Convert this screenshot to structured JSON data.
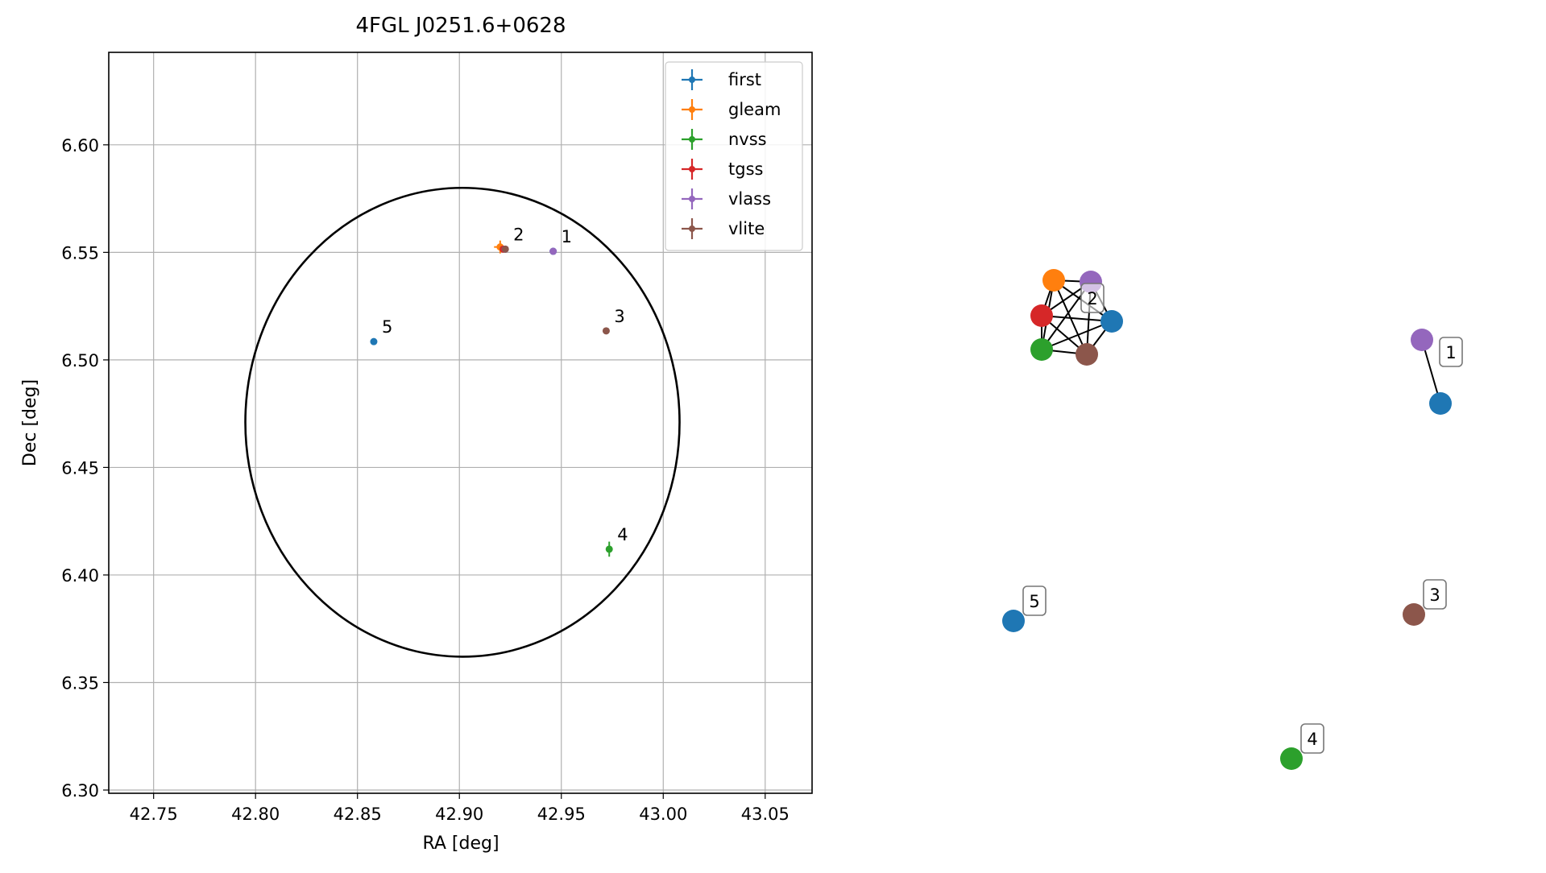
{
  "chart_data": [
    {
      "type": "scatter",
      "title": "4FGL J0251.6+0628",
      "xlabel": "RA [deg]",
      "ylabel": "Dec [deg]",
      "xlim": [
        42.728,
        43.073
      ],
      "ylim": [
        6.2985,
        6.643
      ],
      "xticks": [
        42.75,
        42.8,
        42.85,
        42.9,
        42.95,
        43.0,
        43.05
      ],
      "xtick_labels": [
        "42.75",
        "42.80",
        "42.85",
        "42.90",
        "42.95",
        "43.00",
        "43.05"
      ],
      "yticks": [
        6.3,
        6.35,
        6.4,
        6.45,
        6.5,
        6.55,
        6.6
      ],
      "ytick_labels": [
        "6.30",
        "6.35",
        "6.40",
        "6.45",
        "6.50",
        "6.55",
        "6.60"
      ],
      "grid": true,
      "legend_position": "top-right",
      "series": [
        {
          "name": "first",
          "color": "#1f77b4",
          "points": [
            {
              "x": 42.946,
              "y": 6.5505,
              "xerr": 0.0005,
              "yerr": 0.0005
            },
            {
              "x": 42.858,
              "y": 6.5085,
              "xerr": 0.0005,
              "yerr": 0.0005
            }
          ]
        },
        {
          "name": "gleam",
          "color": "#ff7f0e",
          "points": [
            {
              "x": 42.92,
              "y": 6.5525,
              "xerr": 0.003,
              "yerr": 0.003
            }
          ]
        },
        {
          "name": "nvss",
          "color": "#2ca02c",
          "points": [
            {
              "x": 42.9735,
              "y": 6.412,
              "xerr": 0.0006,
              "yerr": 0.0035
            }
          ]
        },
        {
          "name": "tgss",
          "color": "#d62728",
          "points": [
            {
              "x": 42.9215,
              "y": 6.5515,
              "xerr": 0.001,
              "yerr": 0.001
            }
          ]
        },
        {
          "name": "vlass",
          "color": "#9467bd",
          "points": [
            {
              "x": 42.946,
              "y": 6.5505,
              "xerr": 0.0004,
              "yerr": 0.0004
            },
            {
              "x": 42.9225,
              "y": 6.5515,
              "xerr": 0.0004,
              "yerr": 0.0004
            }
          ]
        },
        {
          "name": "vlite",
          "color": "#8c564b",
          "points": [
            {
              "x": 42.9225,
              "y": 6.5515,
              "xerr": 0.0008,
              "yerr": 0.0008
            },
            {
              "x": 42.972,
              "y": 6.5135,
              "xerr": 0.0008,
              "yerr": 0.0008
            }
          ]
        }
      ],
      "ellipse": {
        "center": [
          42.9015,
          6.471
        ],
        "semi_axes": [
          0.1065,
          0.109
        ]
      },
      "annotations": [
        {
          "text": "1",
          "x": 42.946,
          "y": 6.5505
        },
        {
          "text": "2",
          "x": 42.9225,
          "y": 6.5515
        },
        {
          "text": "3",
          "x": 42.972,
          "y": 6.5135
        },
        {
          "text": "4",
          "x": 42.9735,
          "y": 6.412
        },
        {
          "text": "5",
          "x": 42.858,
          "y": 6.5085
        }
      ]
    },
    {
      "type": "network",
      "clusters": [
        {
          "label": "2",
          "nodes": [
            "#ff7f0e",
            "#9467bd",
            "#d62728",
            "#1f77b4",
            "#2ca02c",
            "#8c564b"
          ],
          "complete_graph": true
        },
        {
          "label": "1",
          "nodes": [
            "#9467bd",
            "#1f77b4"
          ],
          "complete_graph": true
        },
        {
          "label": "5",
          "nodes": [
            "#1f77b4"
          ]
        },
        {
          "label": "3",
          "nodes": [
            "#8c564b"
          ]
        },
        {
          "label": "4",
          "nodes": [
            "#2ca02c"
          ]
        }
      ]
    }
  ]
}
